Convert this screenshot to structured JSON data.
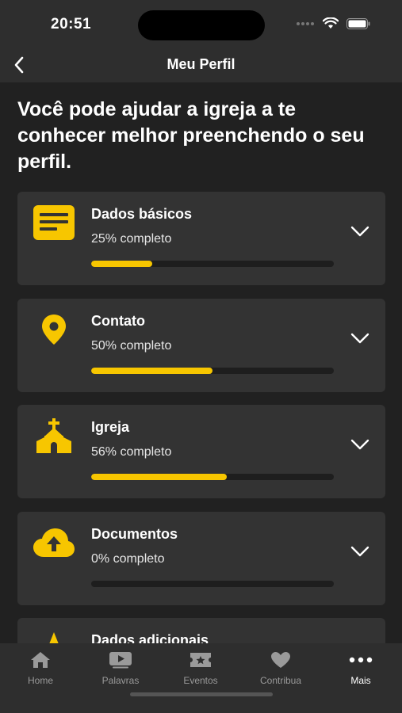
{
  "status": {
    "time": "20:51"
  },
  "nav": {
    "title": "Meu Perfil",
    "back_icon": "chevron-left-icon"
  },
  "intro": "Você pode ajudar a igreja a te conhecer melhor preenchendo o seu perfil.",
  "colors": {
    "accent": "#f7c600",
    "card": "#333333",
    "background": "#212121"
  },
  "sections": [
    {
      "title": "Dados básicos",
      "subtitle": "25% completo",
      "progress": 0.25,
      "icon": "document-lines-icon"
    },
    {
      "title": "Contato",
      "subtitle": "50% completo",
      "progress": 0.5,
      "icon": "location-pin-icon"
    },
    {
      "title": "Igreja",
      "subtitle": "56% completo",
      "progress": 0.56,
      "icon": "church-icon"
    },
    {
      "title": "Documentos",
      "subtitle": "0% completo",
      "progress": 0.0,
      "icon": "cloud-upload-icon"
    },
    {
      "title": "Dados adicionais",
      "icon": "star-icon"
    }
  ],
  "tabs": [
    {
      "label": "Home",
      "icon": "home-icon"
    },
    {
      "label": "Palavras",
      "icon": "play-video-icon"
    },
    {
      "label": "Eventos",
      "icon": "ticket-icon"
    },
    {
      "label": "Contribua",
      "icon": "heart-icon"
    },
    {
      "label": "Mais",
      "icon": "more-dots-icon",
      "active": true
    }
  ]
}
